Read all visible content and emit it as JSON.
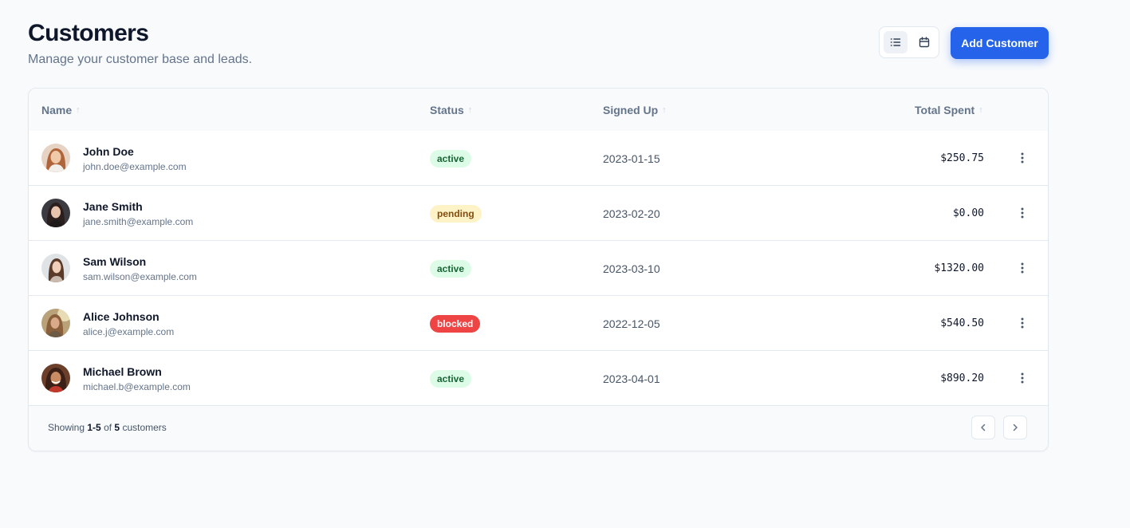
{
  "header": {
    "title": "Customers",
    "subtitle": "Manage your customer base and leads.",
    "add_button_label": "Add Customer",
    "view_toggle": {
      "options": [
        "list-icon",
        "calendar-icon"
      ],
      "selected": "list"
    }
  },
  "table": {
    "columns": [
      {
        "label": "Name",
        "sort_icon": "arrow-up-icon"
      },
      {
        "label": "Status",
        "sort_icon": "arrow-up-icon"
      },
      {
        "label": "Signed Up",
        "sort_icon": "arrow-up-icon"
      },
      {
        "label": "Total Spent",
        "sort_icon": "arrow-up-icon"
      }
    ],
    "rows": [
      {
        "name": "John Doe",
        "email": "john.doe@example.com",
        "status": "active",
        "signed_up": "2023-01-15",
        "total": "$250.75"
      },
      {
        "name": "Jane Smith",
        "email": "jane.smith@example.com",
        "status": "pending",
        "signed_up": "2023-02-20",
        "total": "$0.00"
      },
      {
        "name": "Sam Wilson",
        "email": "sam.wilson@example.com",
        "status": "active",
        "signed_up": "2023-03-10",
        "total": "$1320.00"
      },
      {
        "name": "Alice Johnson",
        "email": "alice.j@example.com",
        "status": "blocked",
        "signed_up": "2022-12-05",
        "total": "$540.50"
      },
      {
        "name": "Michael Brown",
        "email": "michael.b@example.com",
        "status": "active",
        "signed_up": "2023-04-01",
        "total": "$890.20"
      }
    ],
    "row_menu_icon": "more-vertical-icon"
  },
  "footer": {
    "showing_prefix": "Showing",
    "range": "1-5",
    "of_label": "of",
    "total_count": "5",
    "suffix": "customers",
    "prev_icon": "chevron-left-icon",
    "next_icon": "chevron-right-icon"
  },
  "colors": {
    "primary": "#2563eb",
    "active_bg": "#dcfce7",
    "active_text": "#166534",
    "pending_bg": "#fef3c7",
    "pending_text": "#854d0e",
    "blocked_bg": "#ef4444",
    "blocked_text": "#ffffff"
  }
}
